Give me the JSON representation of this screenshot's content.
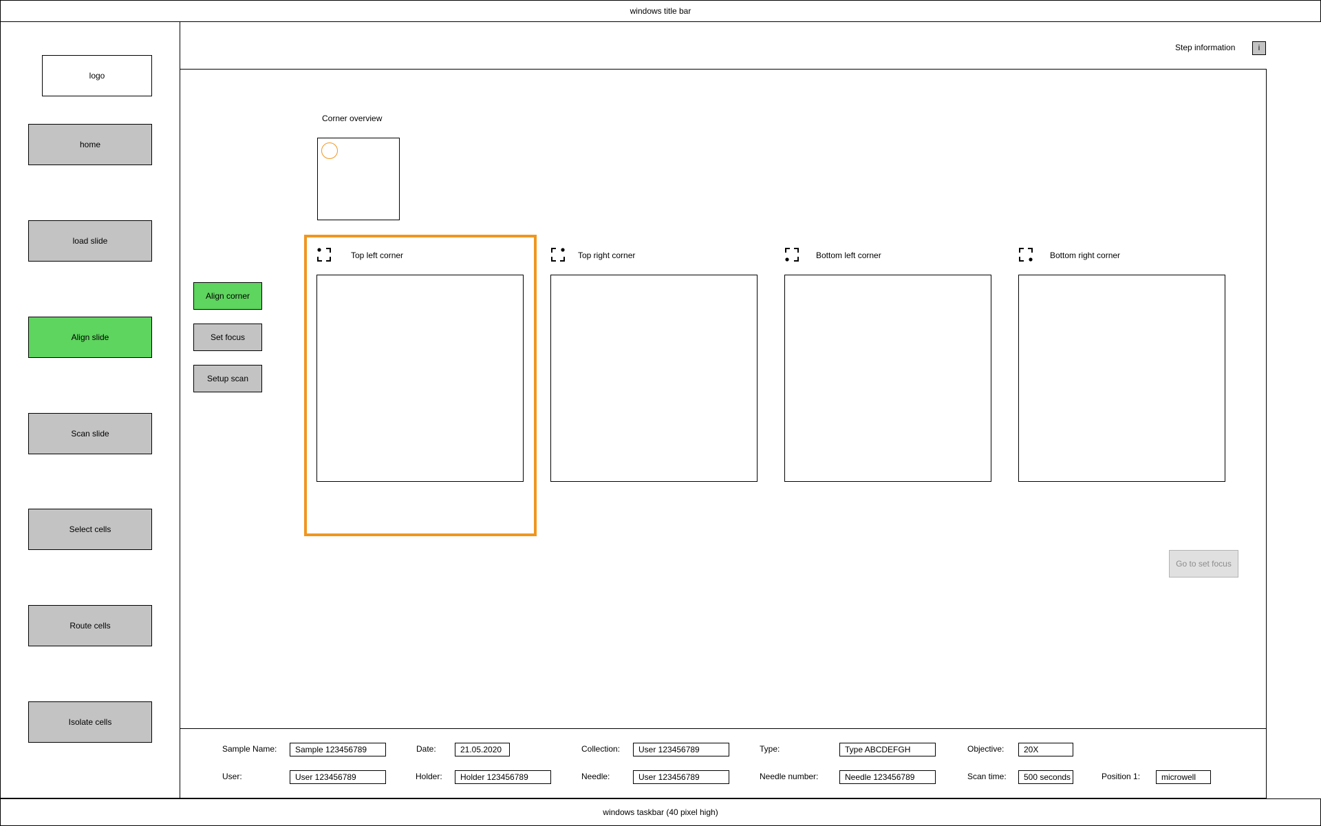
{
  "window": {
    "title_bar": "windows title bar",
    "taskbar": "windows taskbar (40 pixel high)"
  },
  "sidebar": {
    "logo": "logo",
    "items": [
      {
        "label": "home",
        "state": "default"
      },
      {
        "label": "load slide",
        "state": "default"
      },
      {
        "label": "Align slide",
        "state": "active"
      },
      {
        "label": "Scan slide",
        "state": "default"
      },
      {
        "label": "Select cells",
        "state": "default"
      },
      {
        "label": "Route cells",
        "state": "default"
      },
      {
        "label": "Isolate cells",
        "state": "default"
      }
    ]
  },
  "header": {
    "step_information": "Step information",
    "info_button": "i"
  },
  "substeps": [
    {
      "label": "Align corner",
      "state": "active"
    },
    {
      "label": "Set focus",
      "state": "default"
    },
    {
      "label": "Setup scan",
      "state": "default"
    }
  ],
  "overview": {
    "title": "Corner overview"
  },
  "corners": [
    {
      "label": "Top left corner",
      "selected": true
    },
    {
      "label": "Top right corner",
      "selected": false
    },
    {
      "label": "Bottom left corner",
      "selected": false
    },
    {
      "label": "Bottom right corner",
      "selected": false
    }
  ],
  "actions": {
    "go_to_set_focus": "Go to set focus"
  },
  "info_panel": {
    "sample_name_label": "Sample Name:",
    "sample_name_value": "Sample 123456789",
    "date_label": "Date:",
    "date_value": "21.05.2020",
    "collection_label": "Collection:",
    "collection_value": "User 123456789",
    "type_label": "Type:",
    "type_value": "Type ABCDEFGH",
    "objective_label": "Objective:",
    "objective_value": "20X",
    "user_label": "User:",
    "user_value": "User 123456789",
    "holder_label": "Holder:",
    "holder_value": "Holder 123456789",
    "needle_label": "Needle:",
    "needle_value": "User 123456789",
    "needle_number_label": "Needle number:",
    "needle_number_value": "Needle 123456789",
    "scan_time_label": "Scan time:",
    "scan_time_value": "500 seconds",
    "position_label": "Position 1:",
    "position_value": "microwell"
  },
  "colors": {
    "accent_orange": "#f0961e",
    "active_green": "#5ed55e",
    "button_grey": "#c3c3c3",
    "disabled_grey": "#e0e0e0"
  }
}
